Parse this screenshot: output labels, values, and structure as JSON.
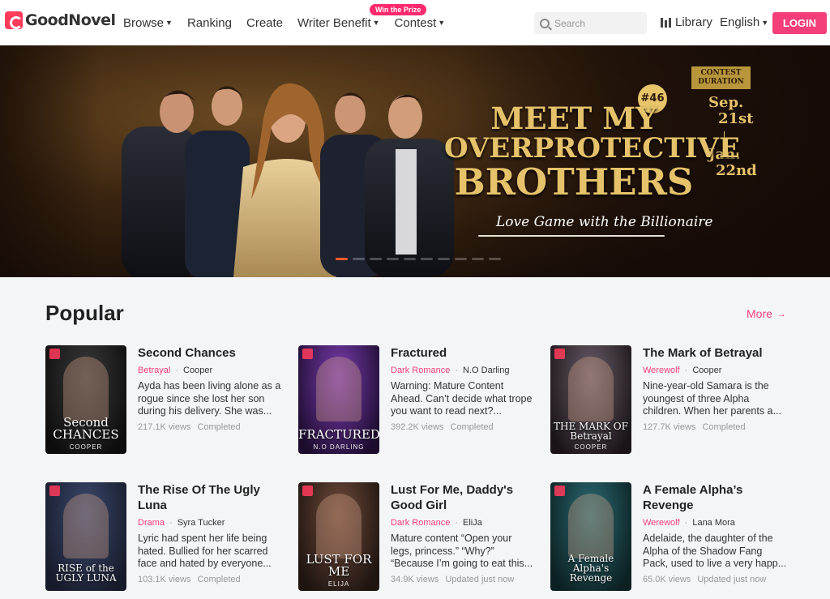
{
  "header": {
    "logo_text": "GoodNovel",
    "nav": [
      {
        "label": "Browse",
        "has_caret": true
      },
      {
        "label": "Ranking",
        "has_caret": false
      },
      {
        "label": "Create",
        "has_caret": false
      },
      {
        "label": "Writer Benefit",
        "has_caret": true
      },
      {
        "label": "Contest",
        "has_caret": true
      }
    ],
    "contest_badge": "Win the Prize",
    "search_placeholder": "Search",
    "library_label": "Library",
    "language_label": "English",
    "login_label": "LOGIN"
  },
  "banner": {
    "title_line1": "MEET MY",
    "title_line2": "OVERPROTECTIVE",
    "title_line3": "BROTHERS",
    "subtitle": "Love Game with the Billionaire",
    "rank": "#46",
    "contest_label": "CONTEST DURATION",
    "start_month": "Sep.",
    "start_day": "21st",
    "end_month": "Jan.",
    "end_day": "22nd",
    "slide_count": 10,
    "active_slide": 0
  },
  "popular": {
    "title": "Popular",
    "more_label": "More",
    "books": [
      {
        "title": "Second Chances",
        "genre": "Betrayal",
        "author": "Cooper",
        "desc": "Ayda has been living alone as a rogue since she lost her son during his delivery. She was...",
        "views": "217.1K views",
        "status": "Completed",
        "cover_text": "Second CHANCES",
        "cover_author": "COOPER",
        "cover_colors": [
          "#3a3a3a",
          "#0d0d0d"
        ]
      },
      {
        "title": "Fractured",
        "genre": "Dark Romance",
        "author": "N.O Darling",
        "desc": "Warning: Mature Content Ahead. Can’t decide what trope you want to read next?...",
        "views": "392.2K views",
        "status": "Completed",
        "cover_text": "FRACTURED",
        "cover_author": "N.O DARLING",
        "cover_colors": [
          "#7a3cb0",
          "#1c0c2e"
        ]
      },
      {
        "title": "The Mark of Betrayal",
        "genre": "Werewolf",
        "author": "Cooper",
        "desc": "Nine-year-old Samara is the youngest of three Alpha children. When her parents a...",
        "views": "127.7K views",
        "status": "Completed",
        "cover_text": "THE MARK OF Betrayal",
        "cover_author": "COOPER",
        "cover_colors": [
          "#6a5d6a",
          "#1a1418"
        ]
      },
      {
        "title": "The Rise Of The Ugly Luna",
        "genre": "Drama",
        "author": "Syra Tucker",
        "desc": "Lyric had spent her life being hated. Bullied for her scarred face and hated by everyone...",
        "views": "103.1K views",
        "status": "Completed",
        "cover_text": "RISE of the UGLY LUNA",
        "cover_author": "",
        "cover_colors": [
          "#3b4a6e",
          "#171a2a"
        ]
      },
      {
        "title": "Lust For Me, Daddy's Good Girl",
        "genre": "Dark Romance",
        "author": "EliJa",
        "desc": "Mature content “Open your legs, princess.” “Why?” “Because I’m going to eat this...",
        "views": "34.9K views",
        "status": "Updated just now",
        "cover_text": "LUST FOR ME",
        "cover_author": "ELIJA",
        "cover_colors": [
          "#6e4a3a",
          "#1e1410"
        ]
      },
      {
        "title": "A Female Alpha’s Revenge",
        "genre": "Werewolf",
        "author": "Lana Mora",
        "desc": "Adelaide, the daughter of the Alpha of the Shadow Fang Pack, used to live a very happ...",
        "views": "65.0K views",
        "status": "Updated just now",
        "cover_text": "A Female Alpha's Revenge",
        "cover_author": "",
        "cover_colors": [
          "#2a6a72",
          "#0c2022"
        ]
      }
    ]
  },
  "colors": {
    "accent": "#f43f7a",
    "gold": "#e6c26a"
  }
}
